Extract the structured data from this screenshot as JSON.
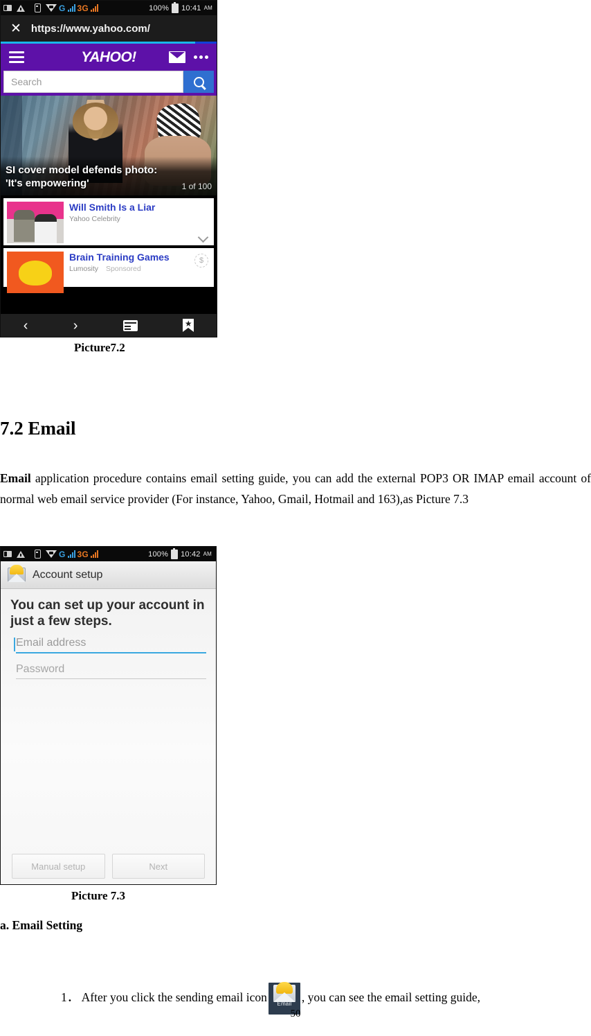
{
  "document": {
    "page_number": "50",
    "heading": "7.2 Email",
    "paragraph_bold_lead": "Email",
    "paragraph_rest": " application procedure contains email setting guide, you can add the external POP3 OR IMAP email account of normal web email service provider (For instance, Yahoo, Gmail, Hotmail and 163),as Picture 7.3",
    "caption_1": "Picture7.2",
    "caption_2": "Picture 7.3",
    "subheading": "a. Email Setting",
    "step_1_prefix": "1．  After you click the sending email icon",
    "step_1_suffix": ", you can see the email setting guide,",
    "inline_icon_label": "Email",
    "inline_icon_name": "email-app-icon"
  },
  "screenshot_browser": {
    "status_bar": {
      "battery": "100%",
      "time": "10:41",
      "ampm": "AM",
      "network_g": "G",
      "network_3g": "3G",
      "icons": [
        "sms-icon",
        "warning-icon",
        "sim-card-icon",
        "wifi-icon",
        "signal-bars-icon",
        "battery-icon"
      ]
    },
    "url_bar": {
      "close_icon": "close-icon",
      "url": "https://www.yahoo.com/",
      "progress_percent": 96
    },
    "yahoo_header": {
      "menu_icon": "hamburger-menu-icon",
      "logo": "YAHOO!",
      "mail_icon": "mail-envelope-icon",
      "more_icon": "more-dots-icon",
      "background": "#5d11a8"
    },
    "search": {
      "placeholder": "Search",
      "button_icon": "search-magnifier-icon",
      "button_color": "#2f6fd0"
    },
    "hero": {
      "headline_line1": "SI cover model defends photo:",
      "headline_line2": "'It's empowering'",
      "counter": "1 of 100"
    },
    "cards": [
      {
        "title": "Will Smith Is a Liar",
        "source": "Yahoo Celebrity",
        "sponsored": "",
        "expand_icon": "chevron-down-icon"
      },
      {
        "title": "Brain Training Games",
        "source": "Lumosity",
        "sponsored": "Sponsored",
        "ad_badge": "$"
      }
    ],
    "bottom_nav": [
      {
        "name": "back-icon",
        "glyph": "‹"
      },
      {
        "name": "forward-icon",
        "glyph": "›"
      },
      {
        "name": "tabs-icon",
        "glyph": ""
      },
      {
        "name": "bookmark-icon",
        "glyph": ""
      }
    ]
  },
  "screenshot_account_setup": {
    "status_bar": {
      "battery": "100%",
      "time": "10:42",
      "ampm": "AM",
      "network_g": "G",
      "network_3g": "3G"
    },
    "header": {
      "icon": "email-envelope-icon",
      "title": "Account setup"
    },
    "body": {
      "title_line1": "You can set up your account in",
      "title_line2": "just a few steps.",
      "email_placeholder": "Email address",
      "password_placeholder": "Password"
    },
    "buttons": {
      "manual_setup": "Manual setup",
      "next": "Next"
    }
  }
}
